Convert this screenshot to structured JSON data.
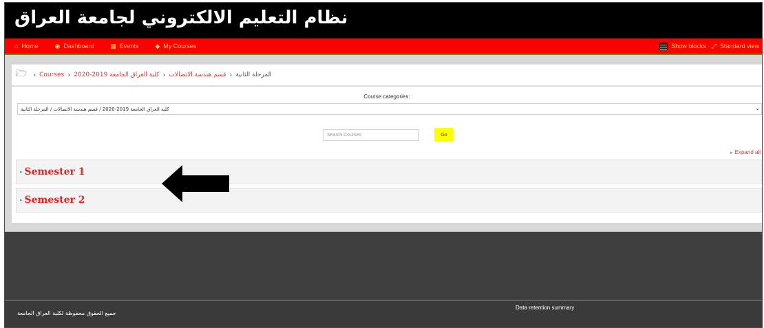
{
  "header": {
    "site_title": "نظام التعليم الالكتروني لجامعة العراق"
  },
  "navbar": {
    "items": [
      {
        "label": "Home",
        "icon": "home-icon",
        "glyph": "⌂"
      },
      {
        "label": "Dashboard",
        "icon": "dashboard-icon",
        "glyph": "◉"
      },
      {
        "label": "Events",
        "icon": "calendar-icon",
        "glyph": "▦"
      },
      {
        "label": "My Courses",
        "icon": "courses-icon",
        "glyph": "◆"
      }
    ],
    "right": {
      "show_blocks": "Show blocks",
      "standard_view": "Standard view",
      "expand_glyph": "⤢"
    },
    "color": "#ff0000",
    "text_color": "#ffd24d"
  },
  "breadcrumb": {
    "folder_glyph": "🗁",
    "separator": "›",
    "items": [
      "Courses",
      "2020-2019 كلية العراق الجامعة",
      "قسم هندسة الاتصالات"
    ],
    "current": "المرحلة الثانية"
  },
  "course_categories": {
    "label": "Course categories:",
    "selected": "كلية العراق الجامعة 2019-2020 / قسم هندسة الاتصالات / المرحلة الثانية",
    "arrow": "⌄"
  },
  "search": {
    "placeholder": "Search Courses",
    "button_label": "Go"
  },
  "expand_all": {
    "label": "Expand all",
    "glyph": "▸"
  },
  "semesters": [
    {
      "label": "Semester 1",
      "glyph": "▸"
    },
    {
      "label": "Semester 2",
      "glyph": "▸"
    }
  ],
  "footer": {
    "copyright": "جميع الحقوق محفوظة لكلية العراق الجامعة",
    "data_retention": "Data retention summary"
  },
  "colors": {
    "header_bg": "#000000",
    "accent_red": "#ff0000",
    "link_red": "#d03a3a",
    "go_button": "#ffff00",
    "footer_bg": "#3f3f3f"
  }
}
